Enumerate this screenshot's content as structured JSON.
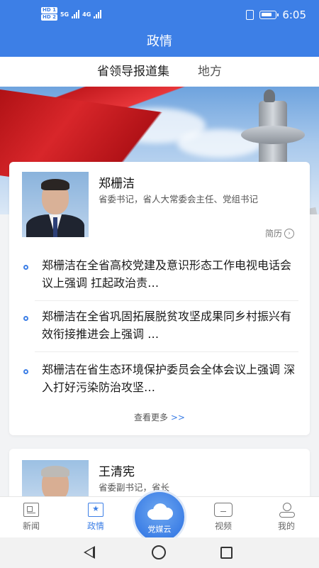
{
  "status": {
    "time": "6:05",
    "hd1": "HD 1",
    "hd2": "HD 2",
    "net1": "5G",
    "net2": "4G"
  },
  "header": {
    "title": "政情"
  },
  "tabs": [
    {
      "label": "省领导报道集",
      "active": true
    },
    {
      "label": "地方",
      "active": false
    }
  ],
  "leaders": [
    {
      "name": "郑栅洁",
      "role": "省委书记，省人大常委会主任、党组书记",
      "resume_label": "简历",
      "news": [
        "郑栅洁在全省高校党建及意识形态工作电视电话会议上强调  扛起政治责…",
        "郑栅洁在全省巩固拓展脱贫攻坚成果同乡村振兴有效衔接推进会上强调  …",
        "郑栅洁在省生态环境保护委员会全体会议上强调  深入打好污染防治攻坚…"
      ],
      "more_label": "查看更多",
      "more_arrow": ">>"
    },
    {
      "name": "王清宪",
      "role": "省委副书记，省长"
    }
  ],
  "tabbar": {
    "items": [
      {
        "label": "新闻",
        "icon": "news-icon"
      },
      {
        "label": "政情",
        "icon": "politics-icon",
        "active": true
      },
      {
        "label": "视频",
        "icon": "video-icon"
      },
      {
        "label": "我的",
        "icon": "profile-icon"
      }
    ],
    "center_label": "党媒云"
  },
  "colors": {
    "primary": "#3d7fe6",
    "background": "#f2f3f5"
  }
}
